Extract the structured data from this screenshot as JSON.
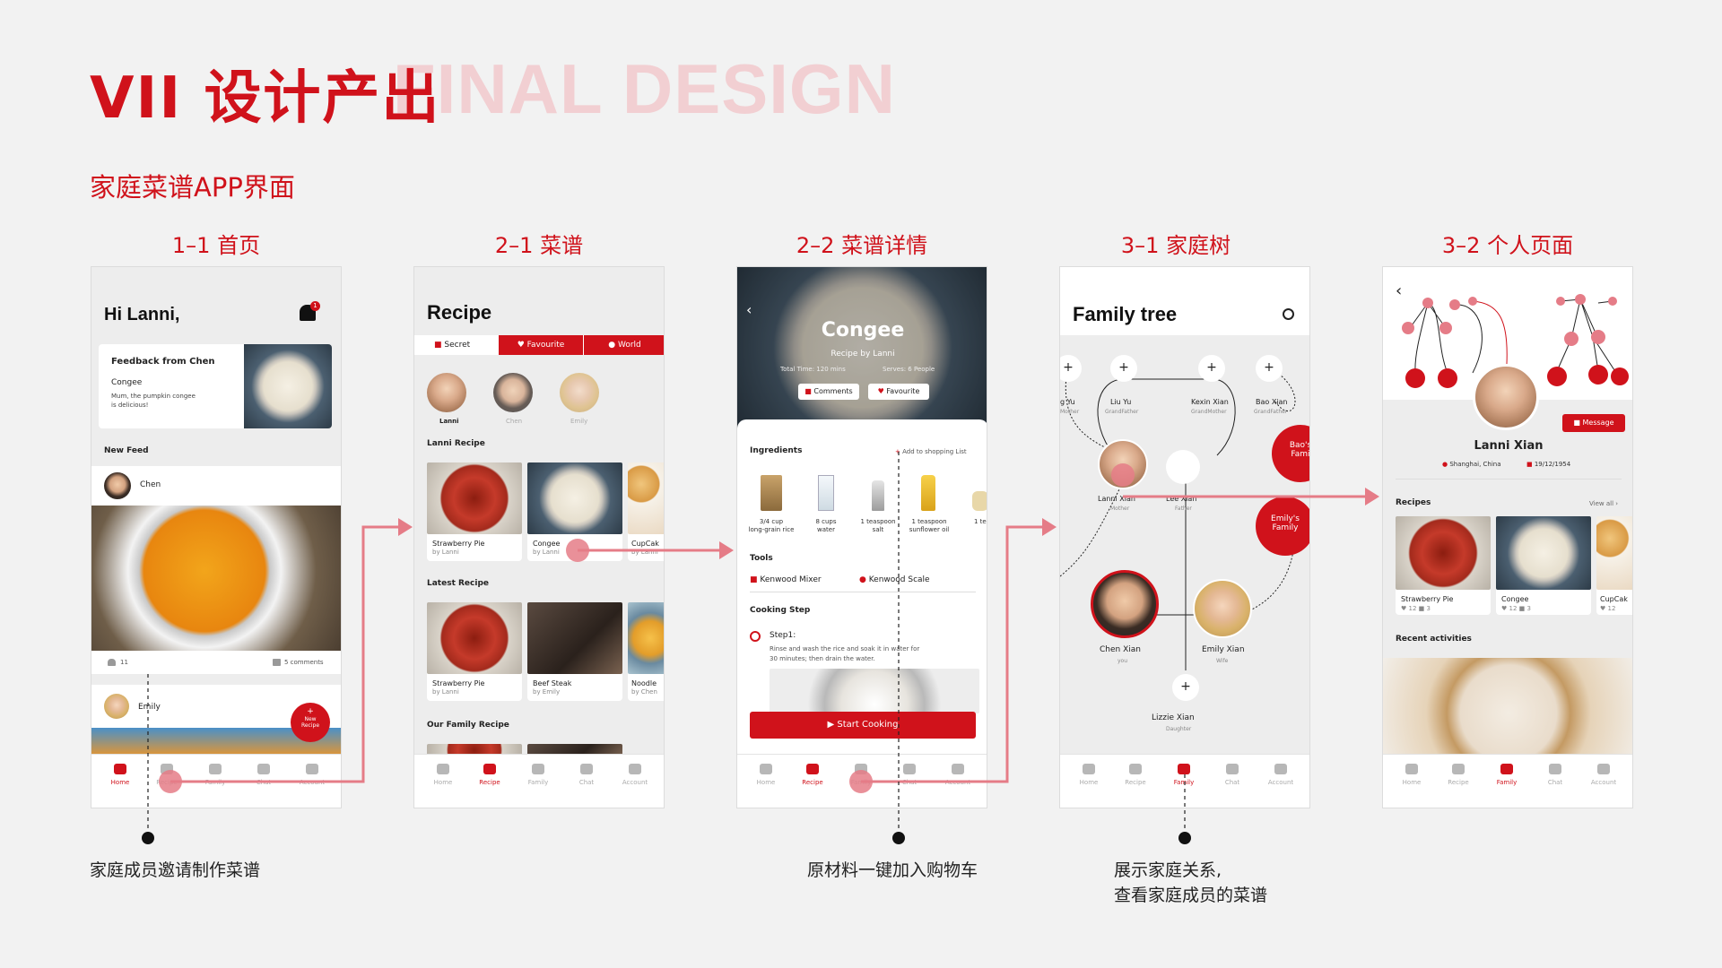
{
  "header": {
    "title": "VII 设计产出",
    "ghost_title": "FINAL DESIGN",
    "subtitle": "家庭菜谱APP界面"
  },
  "screens": [
    {
      "caption": "1–1 首页"
    },
    {
      "caption": "2–1 菜谱"
    },
    {
      "caption": "2–2 菜谱详情"
    },
    {
      "caption": "3–1 家庭树"
    },
    {
      "caption": "3–2 个人页面"
    }
  ],
  "tabs": [
    "Home",
    "Recipe",
    "Family",
    "Chat",
    "Account"
  ],
  "home": {
    "greeting": "Hi Lanni,",
    "badge": "1",
    "feedback_title": "Feedback from Chen",
    "feedback_dish": "Congee",
    "feedback_text_1": "Mum, the pumpkin congee",
    "feedback_text_2": "is delicious!",
    "new_feed": "New Feed",
    "post1_user": "Chen",
    "post1_likes": "11",
    "post1_comments": "5 comments",
    "post2_user": "Emily",
    "fab_plus": "+",
    "fab_line1": "New",
    "fab_line2": "Recipe"
  },
  "recipe": {
    "title": "Recipe",
    "tabs": [
      "Secret",
      "Favourite",
      "World"
    ],
    "people": [
      "Lanni",
      "Chen",
      "Emily"
    ],
    "sec1": "Lanni Recipe",
    "sec1_items": [
      {
        "name": "Strawberry Pie",
        "by": "by Lanni"
      },
      {
        "name": "Congee",
        "by": "by Lanni"
      },
      {
        "name": "CupCak",
        "by": "by Lanni"
      }
    ],
    "sec2": "Latest Recipe",
    "sec2_items": [
      {
        "name": "Strawberry Pie",
        "by": "by Lanni"
      },
      {
        "name": "Beef Steak",
        "by": "by Emily"
      },
      {
        "name": "Noodle",
        "by": "by Chen"
      }
    ],
    "sec3": "Our Family Recipe"
  },
  "detail": {
    "back": "‹",
    "title": "Congee",
    "by": "Recipe by Lanni",
    "time": "Total Time: 120 mins",
    "serves": "Serves: 6 People",
    "comments": "Comments",
    "favourite": "Favourite",
    "ingredients": "Ingredients",
    "add_list": "Add to shopping List",
    "ing": [
      {
        "q": "3/4 cup",
        "n": "long-grain rice"
      },
      {
        "q": "8 cups",
        "n": "water"
      },
      {
        "q": "1 teaspoon",
        "n": "salt"
      },
      {
        "q": "1 teaspoon",
        "n": "sunflower oil"
      },
      {
        "q": "1 te",
        "n": ""
      }
    ],
    "tools": "Tools",
    "tool1": "Kenwood Mixer",
    "tool2": "Kenwood Scale",
    "cooking_step": "Cooking Step",
    "step1": "Step1:",
    "step1_text_1": "Rinse and wash the rice and soak it in water for",
    "step1_text_2": "30 minutes; then drain the water.",
    "start": "Start Cooking"
  },
  "tree": {
    "title": "Family tree",
    "top": [
      {
        "name": "g Yu",
        "role": "Mother"
      },
      {
        "name": "Liu Yu",
        "role": "GrandFather"
      },
      {
        "name": "Kexin Xian",
        "role": "GrandMother"
      },
      {
        "name": "Bao Xian",
        "role": "GrandFather"
      }
    ],
    "mid": [
      {
        "name": "Lanni Xian",
        "role": "Mother"
      },
      {
        "name": "Lee Xian",
        "role": "Father"
      }
    ],
    "bottom": [
      {
        "name": "Chen Xian",
        "role": "you"
      },
      {
        "name": "Emily Xian",
        "role": "Wife"
      }
    ],
    "child": {
      "name": "Lizzie Xian",
      "role": "Daughter"
    },
    "bao_family_1": "Bao's",
    "bao_family_2": "Fami",
    "emily_family_1": "Emily's",
    "emily_family_2": "Family",
    "plus": "+"
  },
  "profile": {
    "back": "‹",
    "name": "Lanni Xian",
    "message": "Message",
    "location": "Shanghai, China",
    "dob": "19/12/1954",
    "recipes": "Recipes",
    "view_all": "View all ›",
    "items": [
      {
        "name": "Strawberry Pie",
        "likes": "12",
        "comments": "3"
      },
      {
        "name": "Congee",
        "likes": "12",
        "comments": "3"
      },
      {
        "name": "CupCak",
        "likes": "12",
        "comments": ""
      }
    ],
    "recent": "Recent activities"
  },
  "notes": {
    "n1": "家庭成员邀请制作菜谱",
    "n2": "原材料一键加入购物车",
    "n3_1": "展示家庭关系,",
    "n3_2": "查看家庭成员的菜谱"
  }
}
